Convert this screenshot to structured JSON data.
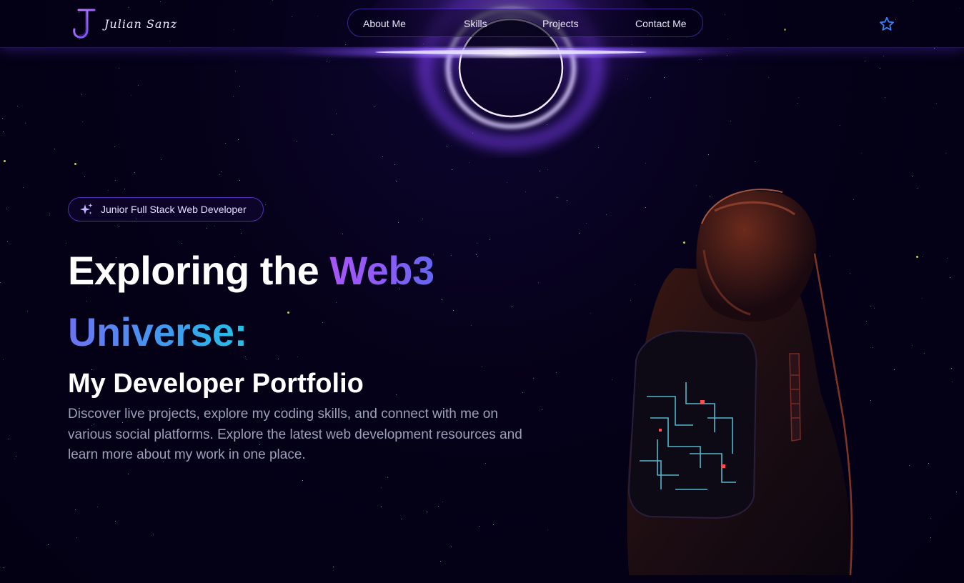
{
  "brand": {
    "logo_letter": "J",
    "name": "Julian Sanz"
  },
  "nav": {
    "links": [
      {
        "label": "About Me"
      },
      {
        "label": "Skills"
      },
      {
        "label": "Projects"
      },
      {
        "label": "Contact Me"
      }
    ],
    "star_icon": "star-outline-icon"
  },
  "hero": {
    "badge": {
      "icon": "sparkles-icon",
      "label": "Junior Full Stack Web Developer"
    },
    "title_part1": "Exploring the ",
    "title_highlight": "Web3",
    "title_line2": "Universe:",
    "subtitle": "My Developer Portfolio",
    "description": "Discover live projects, explore my coding skills, and connect with me on various social platforms. Explore the latest web development resources and learn more about my work in one place."
  },
  "colors": {
    "background": "#030014",
    "accent_purple": "#7042f8",
    "gradient_purple": "#a855f7",
    "gradient_cyan": "#22c3e6",
    "text_muted": "#9aa1b8",
    "star_icon": "#3b82f6"
  }
}
